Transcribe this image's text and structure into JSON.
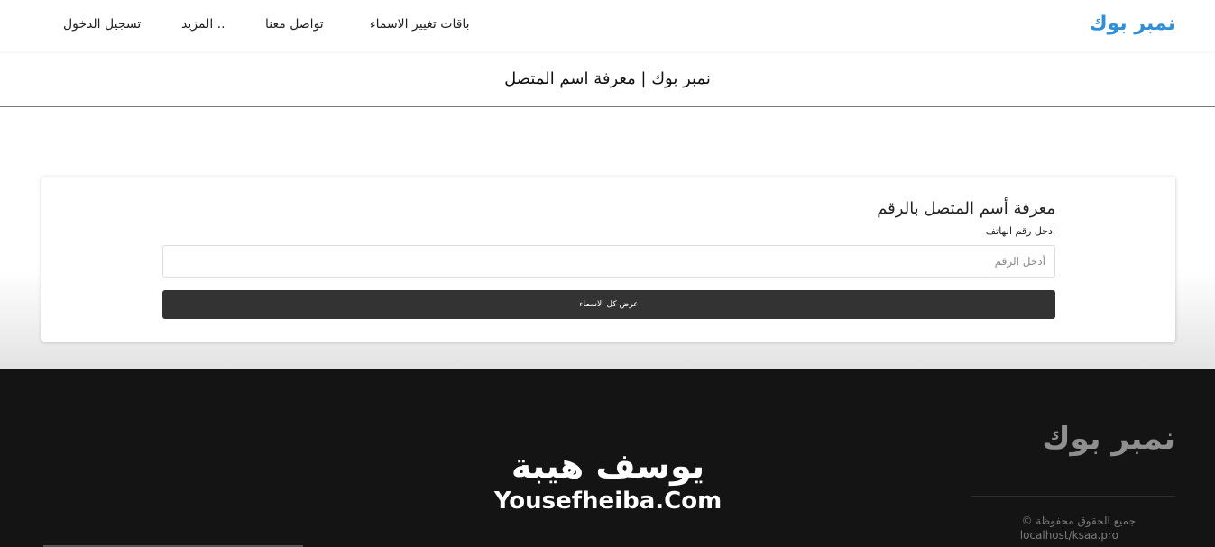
{
  "navbar": {
    "brand": "نمبر بوك",
    "links": {
      "plans": "باقات تغيير الاسماء",
      "contact": "تواصل معنا",
      "more": "المزيد ..",
      "login": "تسجيل الدخول"
    }
  },
  "page": {
    "heading": "نمبر بوك | معرفة اسم المتصل"
  },
  "lookup_form": {
    "title": "معرفة أسم المتصل بالرقم",
    "label": "ادخل رقم الهاتف",
    "input_placeholder": "أدخل الرقم",
    "input_value": "",
    "submit_label": "عرض كل الاسماء"
  },
  "footer": {
    "brand": "نمبر بوك",
    "copyright": "جميع الحقوق محفوظة ©",
    "site": "localhost/ksaa.pro",
    "watermark_ar": "يوسف هيبة",
    "watermark_en": "Yousefheiba.Com"
  },
  "colors": {
    "brand_blue": "#2f8fd8",
    "button_dark": "#333333",
    "footer_bg": "#141414"
  }
}
